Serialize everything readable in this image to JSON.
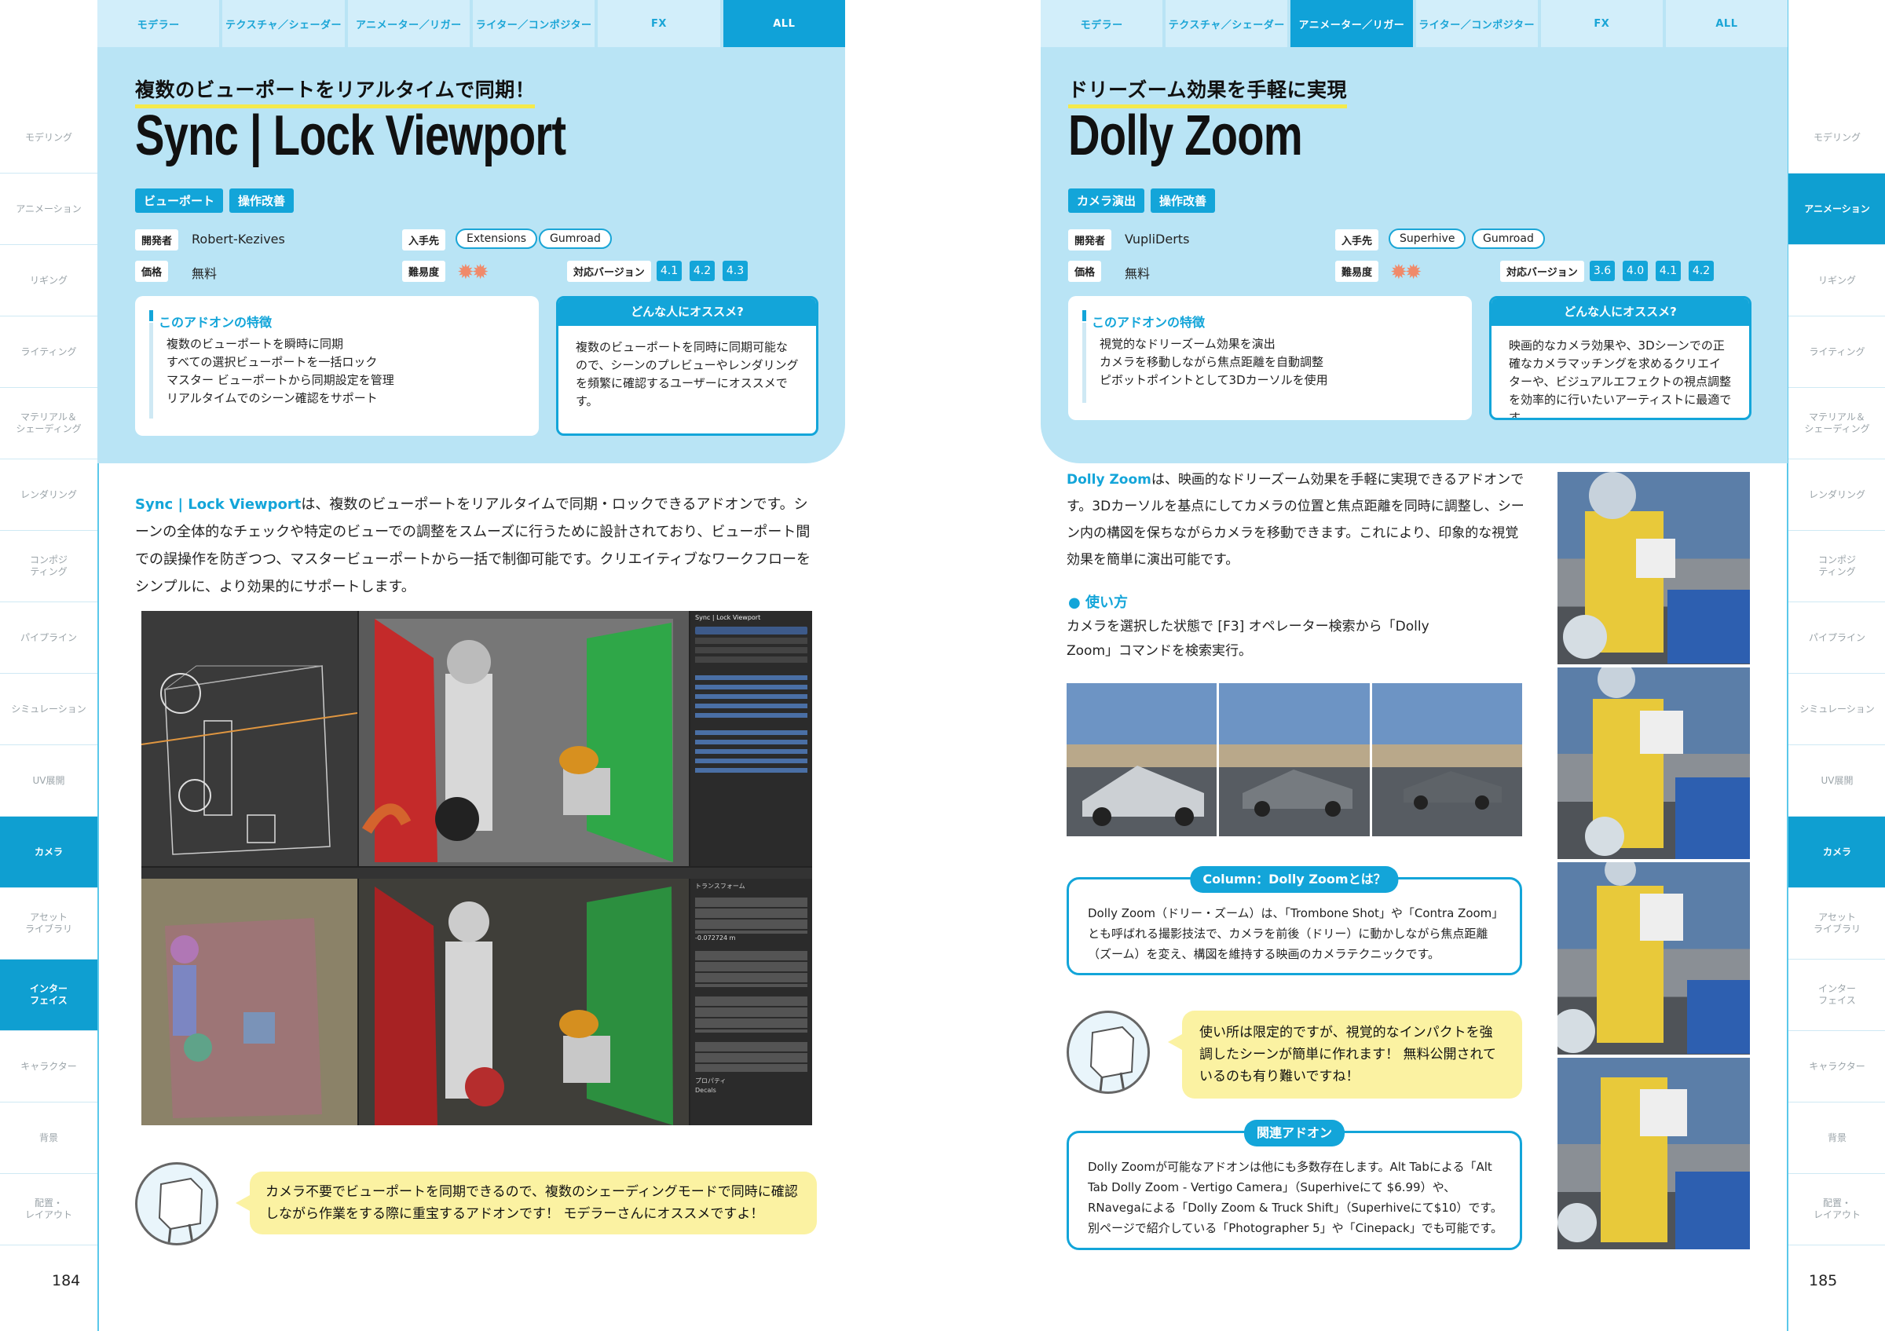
{
  "tabs": [
    "モデラー",
    "テクスチャ／シェーダー",
    "アニメーター／リガー",
    "ライター／コンポジター",
    "FX",
    "ALL"
  ],
  "sidenav": [
    "モデリング",
    "アニメーション",
    "リギング",
    "ライティング",
    "マテリアル＆\nシェーディング",
    "レンダリング",
    "コンポジ\nティング",
    "パイプライン",
    "シミュレーション",
    "UV展開",
    "カメラ",
    "アセット\nライブラリ",
    "インター\nフェイス",
    "キャラクター",
    "背景",
    "配置・\nレイアウト"
  ],
  "labels": {
    "dev": "開発者",
    "price": "価格",
    "source": "入手先",
    "difficulty": "難易度",
    "version": "対応バージョン",
    "features": "このアドオンの特徴",
    "recommend": "どんな人にオススメ?"
  },
  "left": {
    "page_number": "184",
    "active_tab": 5,
    "active_nav": [
      10,
      12
    ],
    "kicker": "複数のビューポートをリアルタイムで同期！",
    "title": "Sync | Lock Viewport",
    "tags": [
      "ビューポート",
      "操作改善"
    ],
    "developer": "Robert-Kezives",
    "price": "無料",
    "sources": [
      "Extensions",
      "Gumroad"
    ],
    "versions": [
      "4.1",
      "4.2",
      "4.3"
    ],
    "features": [
      "複数のビューポートを瞬時に同期",
      "すべての選択ビューポートを一括ロック",
      "マスター ビューポートから同期設定を管理",
      "リアルタイムでのシーン確認をサポート"
    ],
    "recommend": "複数のビューポートを同時に同期可能なので、シーンのプレビューやレンダリングを頻繁に確認するユーザーにオススメです。",
    "body_lead": "Sync | Lock Viewport",
    "body_text": "は、複数のビューポートをリアルタイムで同期・ロックできるアドオンです。シーンの全体的なチェックや特定のビューでの調整をスムーズに行うために設計されており、ビューポート間での誤操作を防ぎつつ、マスタービューポートから一括で制御可能です。クリエイティブなワークフローをシンプルに、より効果的にサポートします。",
    "screenshot": {
      "panel_title": "Sync | Lock Viewport",
      "transform": "トランスフォーム",
      "property": "プロパティ",
      "decals": "Decals",
      "z_value": "-0.072724 m"
    },
    "speech": "カメラ不要でビューポートを同期できるので、複数のシェーディングモードで同時に確認しながら作業をする際に重宝するアドオンです！ モデラーさんにオススメですよ！"
  },
  "right": {
    "page_number": "185",
    "active_tab": 2,
    "active_nav": [
      1,
      10
    ],
    "kicker": "ドリーズーム効果を手軽に実現",
    "title": "Dolly Zoom",
    "tags": [
      "カメラ演出",
      "操作改善"
    ],
    "developer": "VupliDerts",
    "price": "無料",
    "sources": [
      "Superhive",
      "Gumroad"
    ],
    "versions": [
      "3.6",
      "4.0",
      "4.1",
      "4.2"
    ],
    "features": [
      "視覚的なドリーズーム効果を演出",
      "カメラを移動しながら焦点距離を自動調整",
      "ピボットポイントとして3Dカーソルを使用"
    ],
    "recommend": "映画的なカメラ効果や、3Dシーンでの正確なカメラマッチングを求めるクリエイターや、ビジュアルエフェクトの視点調整を効率的に行いたいアーティストに最適です。",
    "body_lead": "Dolly Zoom",
    "body_text": "は、映画的なドリーズーム効果を手軽に実現できるアドオンです。3Dカーソルを基点にしてカメラの位置と焦点距離を同時に調整し、シーン内の構図を保ちながらカメラを移動できます。これにより、印象的な視覚効果を簡単に演出可能です。",
    "howto_title": "● 使い方",
    "howto_text": "カメラを選択した状態で [F3] オペレーター検索から「Dolly Zoom」コマンドを検索実行。",
    "column_title": "Column：Dolly Zoomとは？",
    "column_text": "Dolly Zoom（ドリー・ズーム）は、「Trombone Shot」や「Contra Zoom」とも呼ばれる撮影技法で、カメラを前後（ドリー）に動かしながら焦点距離（ズーム）を変え、構図を維持する映画のカメラテクニックです。",
    "speech": "使い所は限定的ですが、視覚的なインパクトを強調したシーンが簡単に作れます！ 無料公開されているのも有り難いですね！",
    "related_title": "関連アドオン",
    "related_text": "Dolly Zoomが可能なアドオンは他にも多数存在します。Alt Tabによる「Alt Tab Dolly Zoom - Vertigo Camera」（Superhiveにて $6.99）や、RNavegaによる「Dolly Zoom & Truck Shift」（Superhiveにて$10）です。別ページで紹介している「Photographer 5」や「Cinepack」でも可能です。"
  },
  "colors": {
    "accent": "#13a5d9",
    "header_bg": "#b9e4f5",
    "speech_bg": "#fbf2a2",
    "highlight": "#f4ea4c"
  }
}
